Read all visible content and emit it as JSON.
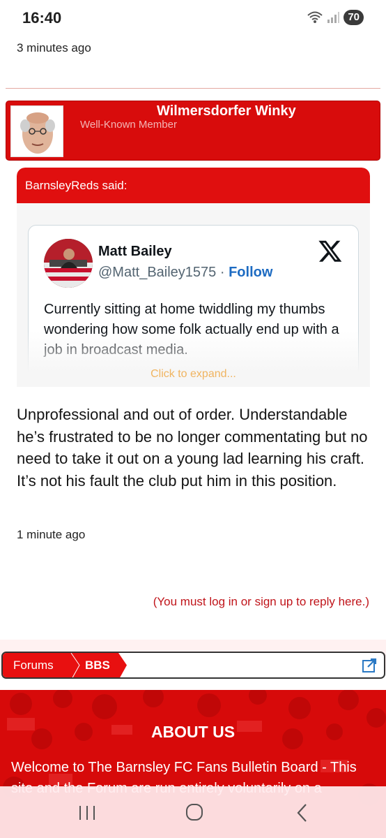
{
  "status_bar": {
    "time": "16:40",
    "battery": "70"
  },
  "post_top": {
    "time": "3 minutes ago"
  },
  "post": {
    "username": "Wilmersdorfer Winky",
    "user_title": "Well-Known Member",
    "quote": {
      "author_said": "BarnsleyReds said:",
      "tweet": {
        "name": "Matt Bailey",
        "handle": "@Matt_Bailey1575",
        "separator": "·",
        "follow": "Follow",
        "text": "Currently sitting at home twiddling my thumbs wondering how some folk actually end up with a job in broadcast media."
      },
      "expand": "Click to expand..."
    },
    "body": "Unprofessional and out of order. Understandable he’s frustrated to be no longer commentating but no need to take it out on a young lad learning his craft. It’s not his fault the club put him in this position.",
    "time": "1 minute ago"
  },
  "reply_notice": "(You must log in or sign up to reply here.)",
  "breadcrumb": {
    "items": [
      "Forums",
      "BBS"
    ]
  },
  "footer": {
    "title": "ABOUT US",
    "text": "Welcome to The Barnsley FC Fans Bulletin Board - This site and the Forum are run entirely voluntarily on a"
  },
  "icons": {
    "x_logo": "x-logo-icon",
    "share": "share-icon",
    "wifi": "wifi-icon",
    "signal": "signal-icon"
  },
  "colors": {
    "brand_red": "#d80c0c",
    "link_blue": "#1d6bc2"
  }
}
